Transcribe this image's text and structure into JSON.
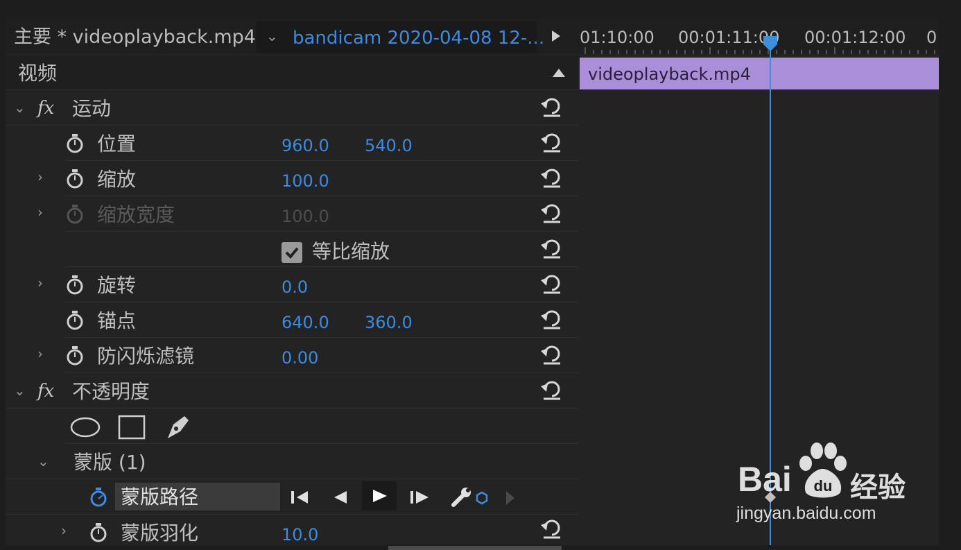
{
  "header": {
    "master_label": "主要 * videoplayback.mp4",
    "sequence_label": "bandicam 2020-04-08 12-..."
  },
  "section": {
    "title": "视频"
  },
  "effects": {
    "motion": {
      "name": "运动",
      "position": {
        "label": "位置",
        "x": "960.0",
        "y": "540.0"
      },
      "scale": {
        "label": "缩放",
        "value": "100.0"
      },
      "scale_width": {
        "label": "缩放宽度",
        "value": "100.0"
      },
      "uniform_scale": {
        "label": "等比缩放",
        "checked": true
      },
      "rotation": {
        "label": "旋转",
        "value": "0.0"
      },
      "anchor": {
        "label": "锚点",
        "x": "640.0",
        "y": "360.0"
      },
      "antiflicker": {
        "label": "防闪烁滤镜",
        "value": "0.00"
      }
    },
    "opacity": {
      "name": "不透明度",
      "mask_group": {
        "label": "蒙版 (1)"
      },
      "mask_path": {
        "label": "蒙版路径"
      },
      "mask_feather": {
        "label": "蒙版羽化",
        "value": "10.0"
      }
    }
  },
  "timeline": {
    "timecodes": [
      "01:10:00",
      "00:01:11:00",
      "00:01:12:00",
      "0"
    ],
    "clip_name": "videoplayback.mp4"
  },
  "watermark": {
    "brand": "Bai",
    "brand2": "经验",
    "url": "jingyan.baidu.com"
  },
  "colors": {
    "accent": "#3d8be0",
    "clip": "#a98ed9",
    "playhead": "#3e8edb"
  }
}
